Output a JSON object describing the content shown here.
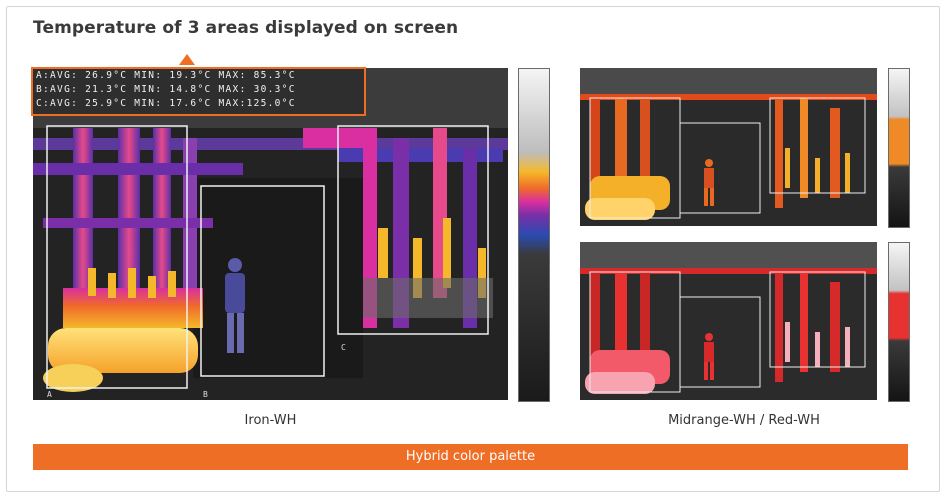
{
  "title": "Temperature of 3 areas displayed on screen",
  "readings": [
    "A:AVG: 26.9°C MIN: 19.3°C MAX: 85.3°C",
    "B:AVG: 21.3°C MIN: 14.8°C MAX: 30.3°C",
    "C:AVG: 25.9°C MIN: 17.6°C MAX:125.0°C"
  ],
  "area_labels": {
    "a": "A",
    "b": "B",
    "c": "C"
  },
  "captions": {
    "left": "Iron-WH",
    "right": "Midrange-WH / Red-WH"
  },
  "footer": "Hybrid color palette",
  "palettes": {
    "iron": [
      "#f2f2f2",
      "#bdbdbd",
      "#f5b82a",
      "#f06a2a",
      "#d92fa0",
      "#7a2fa8",
      "#2a4bb0",
      "#3a3a3a",
      "#1a1a1a"
    ],
    "midrange": [
      "#f4f4f4",
      "#c2c2c2",
      "#f08a26",
      "#3a3a3a",
      "#141414"
    ],
    "red": [
      "#f4f4f4",
      "#c2c2c2",
      "#e83232",
      "#3a3a3a",
      "#141414"
    ]
  },
  "accent": "#ee6e26"
}
